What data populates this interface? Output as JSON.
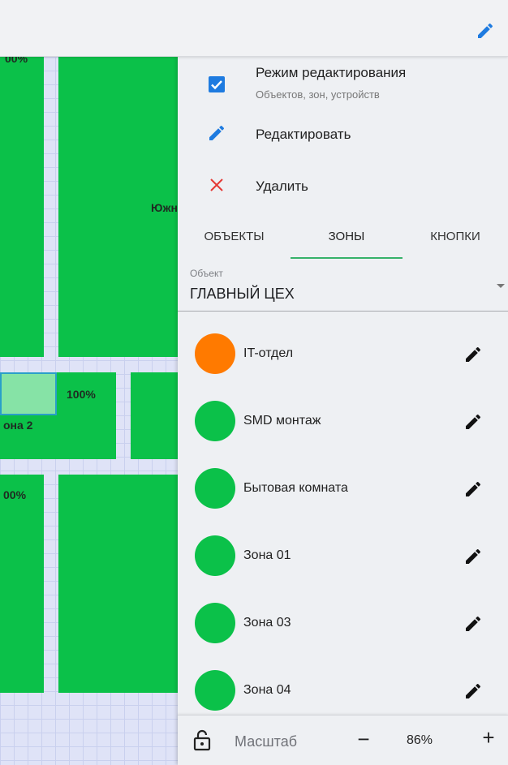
{
  "colors": {
    "accent": "#1e7be0",
    "zone_green": "#0bc149",
    "zone_orange": "#ff7a00",
    "delete_red": "#e53935",
    "tab_underline": "#36b26a"
  },
  "map": {
    "labels": [
      "00%",
      "Южн",
      "100%",
      "она 2",
      "00%"
    ]
  },
  "menu": {
    "edit_mode": {
      "title": "Режим редактирования",
      "subtitle": "Объектов, зон, устройств",
      "checked": true
    },
    "edit": {
      "label": "Редактировать",
      "icon": "pencil-icon"
    },
    "delete": {
      "label": "Удалить",
      "icon": "close-icon"
    }
  },
  "tabs": [
    {
      "label": "ОБЪЕКТЫ",
      "active": false
    },
    {
      "label": "ЗОНЫ",
      "active": true
    },
    {
      "label": "КНОПКИ",
      "active": false
    }
  ],
  "object_select": {
    "label": "Объект",
    "value": "ГЛАВНЫЙ ЦЕХ"
  },
  "zones": [
    {
      "name": "IT-отдел",
      "color": "#ff7a00"
    },
    {
      "name": "SMD монтаж",
      "color": "#0bc149"
    },
    {
      "name": "Бытовая комната",
      "color": "#0bc149"
    },
    {
      "name": "Зона 01",
      "color": "#0bc149"
    },
    {
      "name": "Зона 03",
      "color": "#0bc149"
    },
    {
      "name": "Зона 04",
      "color": "#0bc149"
    }
  ],
  "bottom": {
    "scale_label": "Масштаб",
    "zoom": "86%",
    "minus": "−",
    "plus": "+"
  }
}
